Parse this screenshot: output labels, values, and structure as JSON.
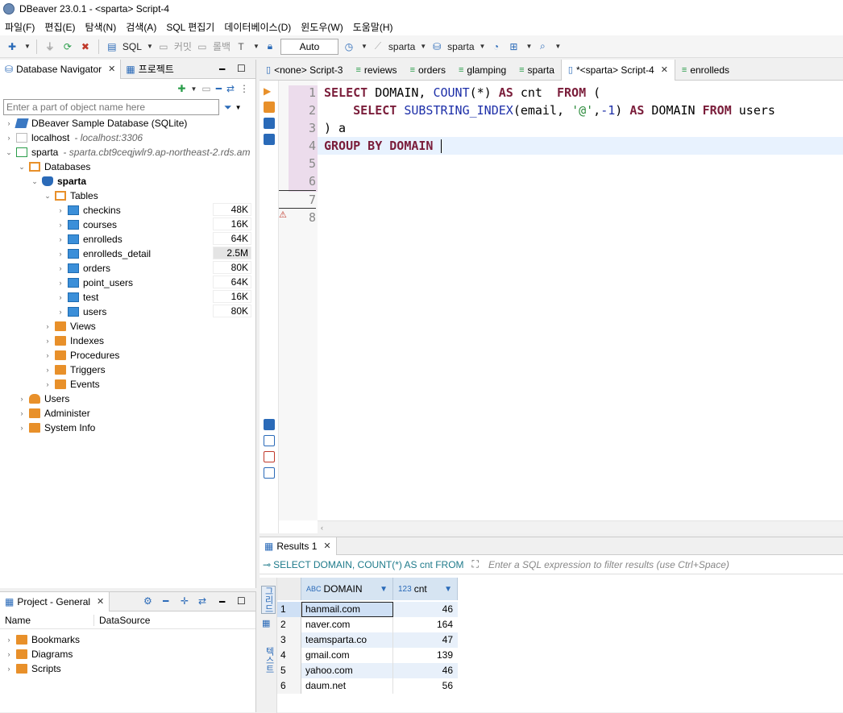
{
  "window": {
    "title": "DBeaver 23.0.1 - <sparta> Script-4"
  },
  "menu": [
    "파일(F)",
    "편집(E)",
    "탐색(N)",
    "검색(A)",
    "SQL 편집기",
    "데이터베이스(D)",
    "윈도우(W)",
    "도움말(H)"
  ],
  "toolbar": {
    "sql_label": "SQL",
    "commit_label": "커밋",
    "rollback_label": "롤백",
    "auto_label": "Auto",
    "datasource": "sparta",
    "schema": "sparta"
  },
  "navigator": {
    "tab_label": "Database Navigator",
    "project_tab_label": "프로젝트",
    "filter_placeholder": "Enter a part of object name here",
    "nodes": {
      "sample": "DBeaver Sample Database (SQLite)",
      "localhost": "localhost",
      "localhost_detail": "- localhost:3306",
      "sparta": "sparta",
      "sparta_detail": "- sparta.cbt9ceqjwlr9.ap-northeast-2.rds.am",
      "databases": "Databases",
      "db_sparta": "sparta",
      "tables": "Tables",
      "views": "Views",
      "indexes": "Indexes",
      "procedures": "Procedures",
      "triggers": "Triggers",
      "events": "Events",
      "users": "Users",
      "administer": "Administer",
      "system_info": "System Info"
    },
    "table_items": [
      {
        "name": "checkins",
        "size": "48K"
      },
      {
        "name": "courses",
        "size": "16K"
      },
      {
        "name": "enrolleds",
        "size": "64K"
      },
      {
        "name": "enrolleds_detail",
        "size": "2.5M"
      },
      {
        "name": "orders",
        "size": "80K"
      },
      {
        "name": "point_users",
        "size": "64K"
      },
      {
        "name": "test",
        "size": "16K"
      },
      {
        "name": "users",
        "size": "80K"
      }
    ]
  },
  "project": {
    "tab_label": "Project - General",
    "col_name": "Name",
    "col_datasource": "DataSource",
    "items": [
      "Bookmarks",
      "Diagrams",
      "Scripts"
    ]
  },
  "editor": {
    "tabs": [
      "<none> Script-3",
      "reviews",
      "orders",
      "glamping",
      "sparta",
      "*<sparta> Script-4",
      "enrolleds"
    ],
    "line_numbers": [
      "1",
      "2",
      "3",
      "4",
      "5",
      "6",
      "7",
      "8"
    ],
    "code": {
      "l1_kw1": "SELECT",
      "l1_t1": " DOMAIN, ",
      "l1_fn": "COUNT",
      "l1_t2": "(*) ",
      "l1_kw2": "AS",
      "l1_t3": " cnt  ",
      "l1_kw3": "FROM",
      "l1_t4": " (",
      "l2_indent": "    ",
      "l2_kw1": "SELECT",
      "l2_t1": " ",
      "l2_fn": "SUBSTRING_INDEX",
      "l2_t2": "(email, ",
      "l2_str": "'@'",
      "l2_t3": ",",
      "l2_num": "-1",
      "l2_t4": ") ",
      "l2_kw2": "AS",
      "l2_t5": " DOMAIN ",
      "l2_kw3": "FROM",
      "l2_t6": " users",
      "l3": ") a",
      "l4_kw": "GROUP BY DOMAIN"
    }
  },
  "results": {
    "tab_label": "Results 1",
    "query_text": "SELECT DOMAIN, COUNT(*) AS cnt FROM",
    "filter_placeholder": "Enter a SQL expression to filter results (use Ctrl+Space)",
    "side_labels": [
      "그리드",
      "텍스트"
    ],
    "columns": [
      {
        "type": "ABC",
        "name": "DOMAIN"
      },
      {
        "type": "123",
        "name": "cnt"
      }
    ],
    "rows": [
      {
        "n": "1",
        "domain": "hanmail.com",
        "cnt": "46"
      },
      {
        "n": "2",
        "domain": "naver.com",
        "cnt": "164"
      },
      {
        "n": "3",
        "domain": "teamsparta.co",
        "cnt": "47"
      },
      {
        "n": "4",
        "domain": "gmail.com",
        "cnt": "139"
      },
      {
        "n": "5",
        "domain": "yahoo.com",
        "cnt": "46"
      },
      {
        "n": "6",
        "domain": "daum.net",
        "cnt": "56"
      }
    ]
  }
}
